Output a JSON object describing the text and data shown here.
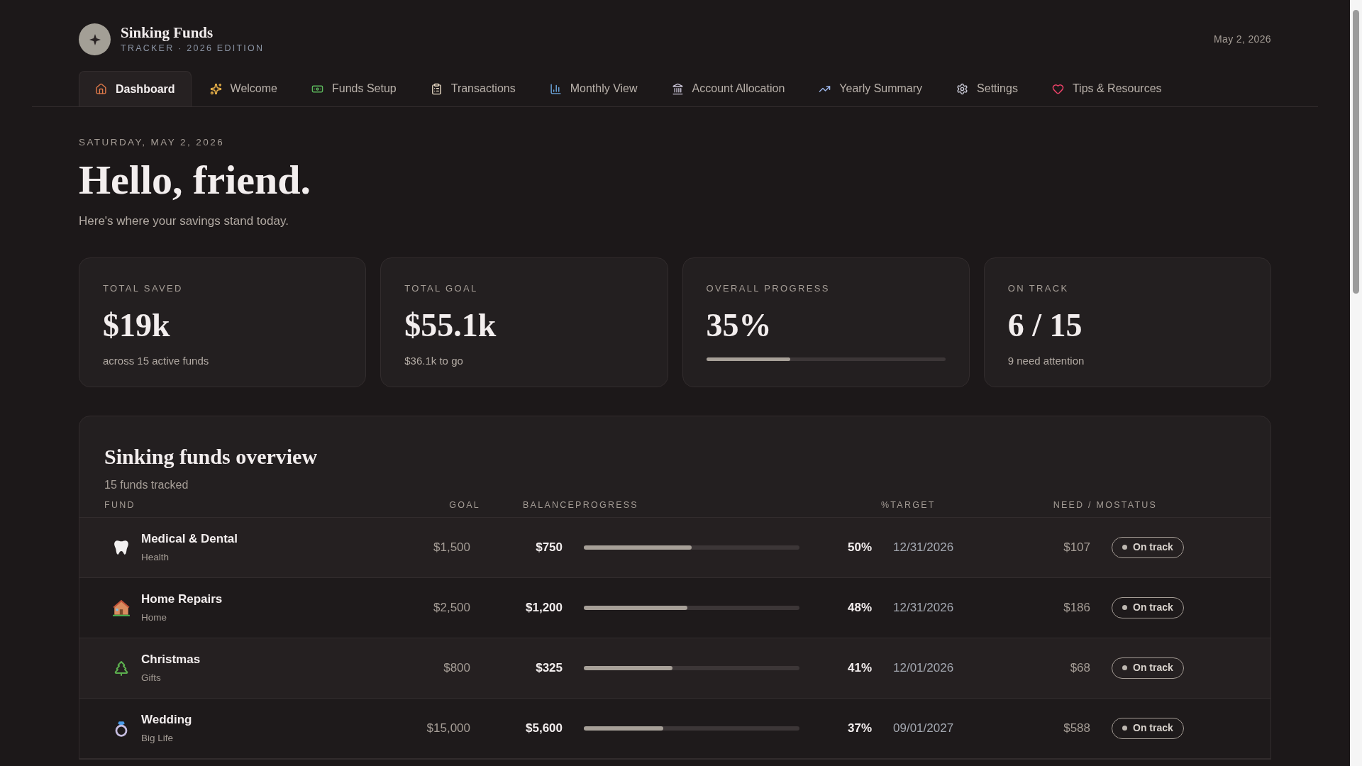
{
  "brand": {
    "title": "Sinking Funds",
    "subtitle": "TRACKER · 2026 EDITION"
  },
  "header_date": "May 2, 2026",
  "tabs": [
    {
      "label": "Dashboard",
      "selected": true
    },
    {
      "label": "Welcome",
      "selected": false
    },
    {
      "label": "Funds Setup",
      "selected": false
    },
    {
      "label": "Transactions",
      "selected": false
    },
    {
      "label": "Monthly View",
      "selected": false
    },
    {
      "label": "Account Allocation",
      "selected": false
    },
    {
      "label": "Yearly Summary",
      "selected": false
    },
    {
      "label": "Settings",
      "selected": false
    },
    {
      "label": "Tips & Resources",
      "selected": false
    }
  ],
  "greeting": {
    "date": "SATURDAY, MAY 2, 2026",
    "title": "Hello, friend.",
    "subtitle": "Here's where your savings stand today."
  },
  "stats": [
    {
      "kind": "text",
      "label": "TOTAL SAVED",
      "value": "$19k",
      "note": "across 15 active funds"
    },
    {
      "kind": "text",
      "label": "TOTAL GOAL",
      "value": "$55.1k",
      "note": "$36.1k to go"
    },
    {
      "kind": "progress",
      "label": "OVERALL PROGRESS",
      "value": "35%",
      "level": 0.35
    },
    {
      "kind": "text",
      "label": "ON TRACK",
      "value": "6 / 15",
      "note": "9 need attention"
    }
  ],
  "overview": {
    "title": "Sinking funds overview",
    "subtitle": "15 funds tracked",
    "columns": [
      "FUND",
      "GOAL",
      "BALANCE",
      "PROGRESS",
      "%",
      "TARGET",
      "NEED / MO",
      "STATUS"
    ],
    "rows": [
      {
        "name": "Medical & Dental",
        "category": "Health",
        "goal": "$1,500",
        "balance": "$750",
        "level": 0.5,
        "percent": "50%",
        "target": "12/31/2026",
        "need": "$107",
        "status": "On track"
      },
      {
        "name": "Home Repairs",
        "category": "Home",
        "goal": "$2,500",
        "balance": "$1,200",
        "level": 0.48,
        "percent": "48%",
        "target": "12/31/2026",
        "need": "$186",
        "status": "On track"
      },
      {
        "name": "Christmas",
        "category": "Gifts",
        "goal": "$800",
        "balance": "$325",
        "level": 0.41,
        "percent": "41%",
        "target": "12/01/2026",
        "need": "$68",
        "status": "On track"
      },
      {
        "name": "Wedding",
        "category": "Big Life",
        "goal": "$15,000",
        "balance": "$5,600",
        "level": 0.37,
        "percent": "37%",
        "target": "09/01/2027",
        "need": "$588",
        "status": "On track"
      }
    ]
  }
}
